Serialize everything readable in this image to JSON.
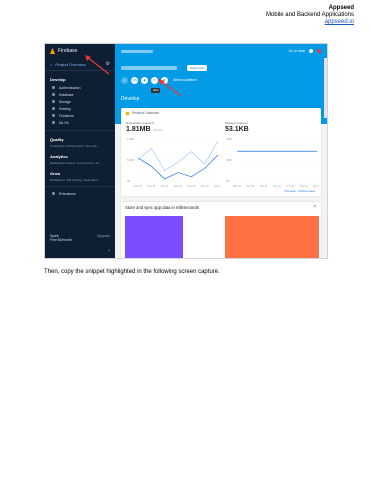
{
  "header": {
    "title": "Appseed",
    "subtitle": "Mobile and Backend Applications",
    "link": "appseed.io"
  },
  "sidebar": {
    "brand": "Firebase",
    "overview": "Project Overview",
    "develop_heading": "Develop",
    "develop_items": [
      "Authentication",
      "Database",
      "Storage",
      "Hosting",
      "Functions",
      "ML Kit"
    ],
    "quality_heading": "Quality",
    "quality_sub": "Crashlytics, Performance, Test Lab...",
    "analytics_heading": "Analytics",
    "analytics_sub": "Dashboard, Events, Conversions, Au...",
    "grow_heading": "Grow",
    "grow_sub": "Predictions, A/B Testing, Cloud Mes...",
    "extensions": "Extensions",
    "plan_name": "Spark",
    "plan_desc": "Free $0/month",
    "upgrade": "Upgrade"
  },
  "topbar": {
    "docs": "Go to docs"
  },
  "project": {
    "plan_chip": "Spark plan"
  },
  "platforms": {
    "items": [
      "iOS",
      "</>",
      "⚙"
    ],
    "add_label": "Add app",
    "select_label": "Select a platform"
  },
  "tooltip": "Web",
  "main": {
    "section_title": "Develop"
  },
  "card": {
    "title": "Realtime Database",
    "stat1_label": "Downloads (Current)",
    "stat1_value": "1.81MB",
    "stat1_delta": "-46.3%",
    "stat2_label": "Storage (current)",
    "stat2_value": "53.1KB",
    "legend": "This week  ·  Previous week"
  },
  "chart_data": [
    {
      "type": "line",
      "x": [
        "Nov 19",
        "Nov 20",
        "Nov 21",
        "Nov 22",
        "Nov 23",
        "Nov 24",
        "Nov 25"
      ],
      "series": [
        {
          "values": [
            0.55,
            0.35,
            0.05,
            0.2,
            0.1,
            0.3,
            0.62
          ]
        },
        {
          "values": [
            0.5,
            0.78,
            0.25,
            0.45,
            0.7,
            0.4,
            0.95
          ]
        }
      ],
      "yticks": [
        "1.0MB",
        "500KB",
        "0B"
      ],
      "ylim": [
        0,
        1
      ]
    },
    {
      "type": "line",
      "x": [
        "Nov 19",
        "Nov 20",
        "Nov 21",
        "Nov 22",
        "Nov 23",
        "Nov 24",
        "Nov 25"
      ],
      "series": [
        {
          "values": [
            53.1,
            53.1,
            53.1,
            53.1,
            53.1,
            53.1,
            53.1
          ]
        }
      ],
      "yticks": [
        "75KB",
        "50KB",
        "0B"
      ],
      "ylim": [
        0,
        75
      ]
    }
  ],
  "promo": {
    "title": "Store and sync app data in milliseconds",
    "close": "×"
  },
  "caption": "Then, copy the snippet highlighted in the following screen capture.",
  "colors": {
    "sidebar": "#0f1f33",
    "band": "#039be5",
    "accent": "#1a73e8",
    "arrow": "#e53935"
  }
}
